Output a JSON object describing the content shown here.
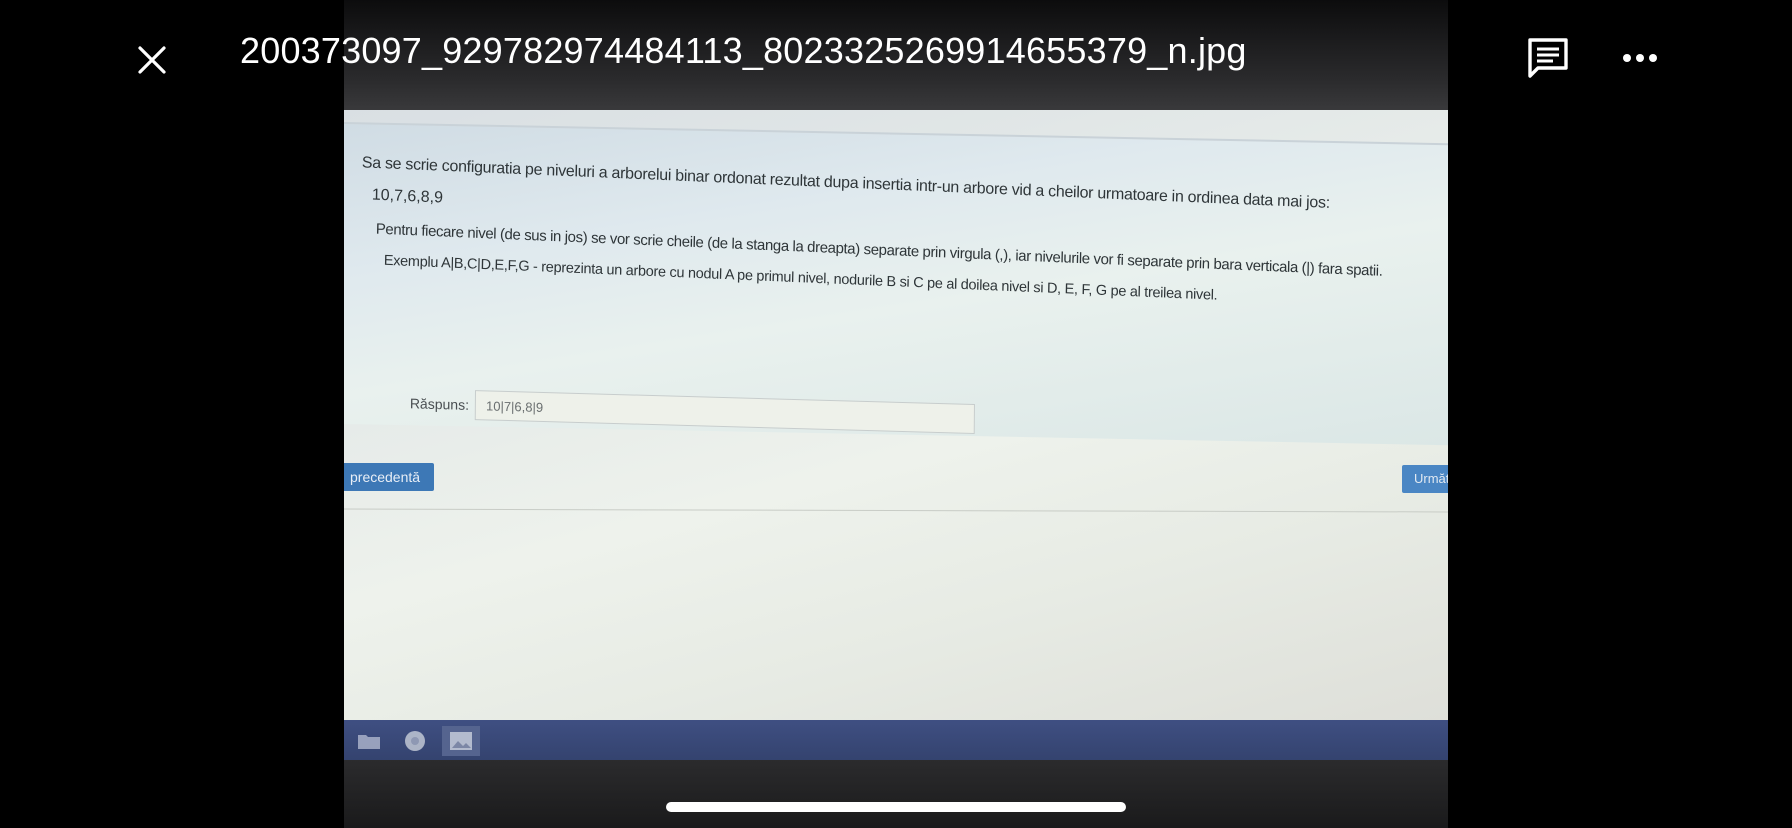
{
  "viewer": {
    "filename": "200373097_929782974484113_8023325269914655379_n.jpg"
  },
  "photo": {
    "question": {
      "line1": "Sa se scrie configuratia pe niveluri a arborelui binar ordonat rezultat dupa insertia intr-un arbore vid a cheilor urmatoare in ordinea data mai jos:",
      "keys": "10,7,6,8,9",
      "line3": "Pentru fiecare nivel (de sus in jos) se vor scrie cheile (de la stanga la dreapta) separate prin virgula (,), iar nivelurile vor fi separate prin bara verticala (|) fara spatii.",
      "line4": "Exemplu A|B,C|D,E,F,G - reprezinta un arbore cu nodul A pe primul nivel, nodurile B si C pe al doilea nivel si D, E, F, G pe al treilea nivel."
    },
    "answer": {
      "label": "Răspuns:",
      "value": "10|7|6,8|9"
    },
    "nav": {
      "prev_label": "precedentă",
      "next_label": "Următ"
    }
  },
  "colors": {
    "background": "#000000",
    "button_blue": "#3d78b6",
    "taskbar": "#3f4f82"
  }
}
